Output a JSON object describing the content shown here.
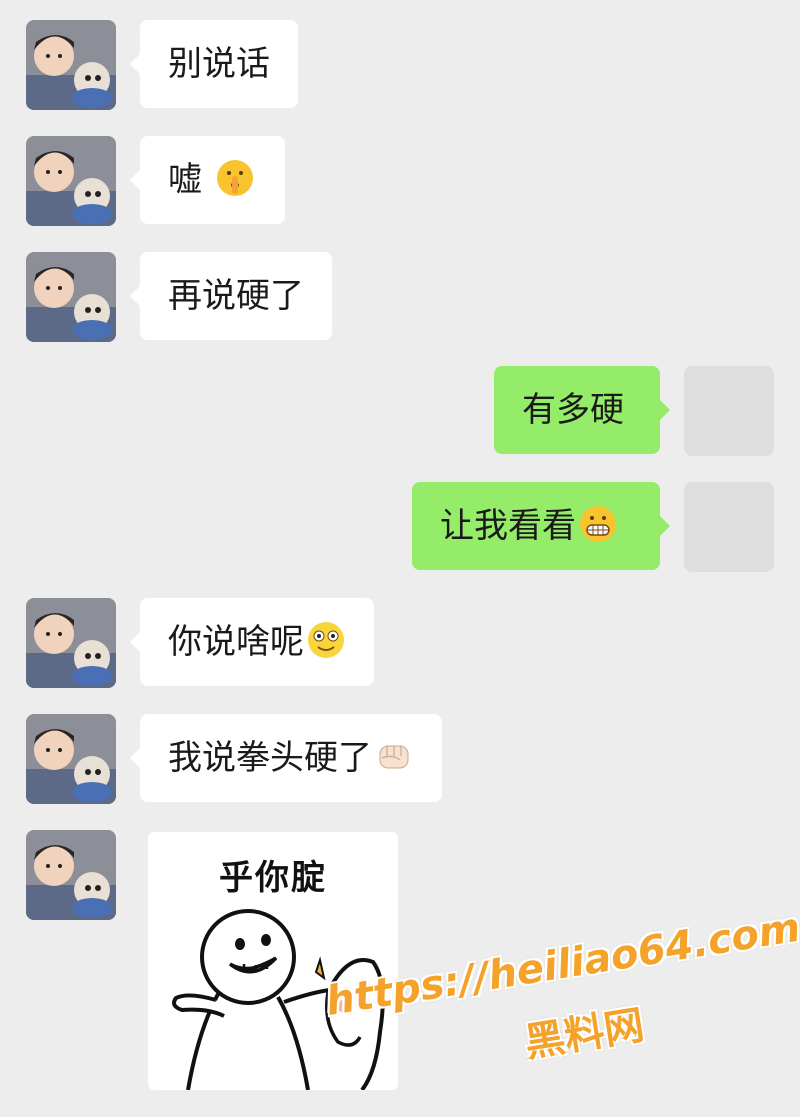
{
  "messages": [
    {
      "side": "in",
      "text": "别说话",
      "emoji": ""
    },
    {
      "side": "in",
      "text": "嘘",
      "emoji": "shushing-face"
    },
    {
      "side": "in",
      "text": "再说硬了",
      "emoji": ""
    },
    {
      "side": "out",
      "text": "有多硬",
      "emoji": ""
    },
    {
      "side": "out",
      "text": "让我看看",
      "emoji": "grimacing-face"
    },
    {
      "side": "in",
      "text": "你说啥呢",
      "emoji": "smiley-face"
    },
    {
      "side": "in",
      "text": "我说拳头硬了",
      "emoji": "fist"
    }
  ],
  "sticker": {
    "caption": "乎你腚"
  },
  "watermark": {
    "url": "https://heiliao64.com",
    "name": "黑料网"
  },
  "colors": {
    "background": "#ededed",
    "incoming_bubble": "#ffffff",
    "outgoing_bubble": "#95ec69",
    "watermark": "#f4a22a"
  }
}
